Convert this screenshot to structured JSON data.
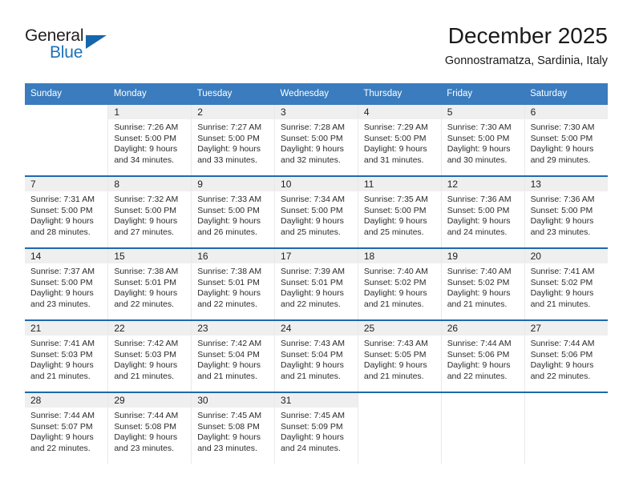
{
  "brand": {
    "name_top": "General",
    "name_bottom": "Blue",
    "triangle_color": "#1566ab",
    "blue_text_color": "#1d72b8"
  },
  "header": {
    "title": "December 2025",
    "subtitle": "Gonnostramatza, Sardinia, Italy"
  },
  "theme": {
    "header_row_bg": "#3a7cbe",
    "week_separator": "#1f69ad",
    "daynum_band_bg": "#efefef"
  },
  "weekdays": [
    "Sunday",
    "Monday",
    "Tuesday",
    "Wednesday",
    "Thursday",
    "Friday",
    "Saturday"
  ],
  "weeks": [
    [
      {
        "day": "",
        "blank": true,
        "sunrise": "",
        "sunset": "",
        "daylight1": "",
        "daylight2": ""
      },
      {
        "day": "1",
        "sunrise": "Sunrise: 7:26 AM",
        "sunset": "Sunset: 5:00 PM",
        "daylight1": "Daylight: 9 hours",
        "daylight2": "and 34 minutes."
      },
      {
        "day": "2",
        "sunrise": "Sunrise: 7:27 AM",
        "sunset": "Sunset: 5:00 PM",
        "daylight1": "Daylight: 9 hours",
        "daylight2": "and 33 minutes."
      },
      {
        "day": "3",
        "sunrise": "Sunrise: 7:28 AM",
        "sunset": "Sunset: 5:00 PM",
        "daylight1": "Daylight: 9 hours",
        "daylight2": "and 32 minutes."
      },
      {
        "day": "4",
        "sunrise": "Sunrise: 7:29 AM",
        "sunset": "Sunset: 5:00 PM",
        "daylight1": "Daylight: 9 hours",
        "daylight2": "and 31 minutes."
      },
      {
        "day": "5",
        "sunrise": "Sunrise: 7:30 AM",
        "sunset": "Sunset: 5:00 PM",
        "daylight1": "Daylight: 9 hours",
        "daylight2": "and 30 minutes."
      },
      {
        "day": "6",
        "sunrise": "Sunrise: 7:30 AM",
        "sunset": "Sunset: 5:00 PM",
        "daylight1": "Daylight: 9 hours",
        "daylight2": "and 29 minutes."
      }
    ],
    [
      {
        "day": "7",
        "sunrise": "Sunrise: 7:31 AM",
        "sunset": "Sunset: 5:00 PM",
        "daylight1": "Daylight: 9 hours",
        "daylight2": "and 28 minutes."
      },
      {
        "day": "8",
        "sunrise": "Sunrise: 7:32 AM",
        "sunset": "Sunset: 5:00 PM",
        "daylight1": "Daylight: 9 hours",
        "daylight2": "and 27 minutes."
      },
      {
        "day": "9",
        "sunrise": "Sunrise: 7:33 AM",
        "sunset": "Sunset: 5:00 PM",
        "daylight1": "Daylight: 9 hours",
        "daylight2": "and 26 minutes."
      },
      {
        "day": "10",
        "sunrise": "Sunrise: 7:34 AM",
        "sunset": "Sunset: 5:00 PM",
        "daylight1": "Daylight: 9 hours",
        "daylight2": "and 25 minutes."
      },
      {
        "day": "11",
        "sunrise": "Sunrise: 7:35 AM",
        "sunset": "Sunset: 5:00 PM",
        "daylight1": "Daylight: 9 hours",
        "daylight2": "and 25 minutes."
      },
      {
        "day": "12",
        "sunrise": "Sunrise: 7:36 AM",
        "sunset": "Sunset: 5:00 PM",
        "daylight1": "Daylight: 9 hours",
        "daylight2": "and 24 minutes."
      },
      {
        "day": "13",
        "sunrise": "Sunrise: 7:36 AM",
        "sunset": "Sunset: 5:00 PM",
        "daylight1": "Daylight: 9 hours",
        "daylight2": "and 23 minutes."
      }
    ],
    [
      {
        "day": "14",
        "sunrise": "Sunrise: 7:37 AM",
        "sunset": "Sunset: 5:00 PM",
        "daylight1": "Daylight: 9 hours",
        "daylight2": "and 23 minutes."
      },
      {
        "day": "15",
        "sunrise": "Sunrise: 7:38 AM",
        "sunset": "Sunset: 5:01 PM",
        "daylight1": "Daylight: 9 hours",
        "daylight2": "and 22 minutes."
      },
      {
        "day": "16",
        "sunrise": "Sunrise: 7:38 AM",
        "sunset": "Sunset: 5:01 PM",
        "daylight1": "Daylight: 9 hours",
        "daylight2": "and 22 minutes."
      },
      {
        "day": "17",
        "sunrise": "Sunrise: 7:39 AM",
        "sunset": "Sunset: 5:01 PM",
        "daylight1": "Daylight: 9 hours",
        "daylight2": "and 22 minutes."
      },
      {
        "day": "18",
        "sunrise": "Sunrise: 7:40 AM",
        "sunset": "Sunset: 5:02 PM",
        "daylight1": "Daylight: 9 hours",
        "daylight2": "and 21 minutes."
      },
      {
        "day": "19",
        "sunrise": "Sunrise: 7:40 AM",
        "sunset": "Sunset: 5:02 PM",
        "daylight1": "Daylight: 9 hours",
        "daylight2": "and 21 minutes."
      },
      {
        "day": "20",
        "sunrise": "Sunrise: 7:41 AM",
        "sunset": "Sunset: 5:02 PM",
        "daylight1": "Daylight: 9 hours",
        "daylight2": "and 21 minutes."
      }
    ],
    [
      {
        "day": "21",
        "sunrise": "Sunrise: 7:41 AM",
        "sunset": "Sunset: 5:03 PM",
        "daylight1": "Daylight: 9 hours",
        "daylight2": "and 21 minutes."
      },
      {
        "day": "22",
        "sunrise": "Sunrise: 7:42 AM",
        "sunset": "Sunset: 5:03 PM",
        "daylight1": "Daylight: 9 hours",
        "daylight2": "and 21 minutes."
      },
      {
        "day": "23",
        "sunrise": "Sunrise: 7:42 AM",
        "sunset": "Sunset: 5:04 PM",
        "daylight1": "Daylight: 9 hours",
        "daylight2": "and 21 minutes."
      },
      {
        "day": "24",
        "sunrise": "Sunrise: 7:43 AM",
        "sunset": "Sunset: 5:04 PM",
        "daylight1": "Daylight: 9 hours",
        "daylight2": "and 21 minutes."
      },
      {
        "day": "25",
        "sunrise": "Sunrise: 7:43 AM",
        "sunset": "Sunset: 5:05 PM",
        "daylight1": "Daylight: 9 hours",
        "daylight2": "and 21 minutes."
      },
      {
        "day": "26",
        "sunrise": "Sunrise: 7:44 AM",
        "sunset": "Sunset: 5:06 PM",
        "daylight1": "Daylight: 9 hours",
        "daylight2": "and 22 minutes."
      },
      {
        "day": "27",
        "sunrise": "Sunrise: 7:44 AM",
        "sunset": "Sunset: 5:06 PM",
        "daylight1": "Daylight: 9 hours",
        "daylight2": "and 22 minutes."
      }
    ],
    [
      {
        "day": "28",
        "sunrise": "Sunrise: 7:44 AM",
        "sunset": "Sunset: 5:07 PM",
        "daylight1": "Daylight: 9 hours",
        "daylight2": "and 22 minutes."
      },
      {
        "day": "29",
        "sunrise": "Sunrise: 7:44 AM",
        "sunset": "Sunset: 5:08 PM",
        "daylight1": "Daylight: 9 hours",
        "daylight2": "and 23 minutes."
      },
      {
        "day": "30",
        "sunrise": "Sunrise: 7:45 AM",
        "sunset": "Sunset: 5:08 PM",
        "daylight1": "Daylight: 9 hours",
        "daylight2": "and 23 minutes."
      },
      {
        "day": "31",
        "sunrise": "Sunrise: 7:45 AM",
        "sunset": "Sunset: 5:09 PM",
        "daylight1": "Daylight: 9 hours",
        "daylight2": "and 24 minutes."
      },
      {
        "day": "",
        "blank": true,
        "sunrise": "",
        "sunset": "",
        "daylight1": "",
        "daylight2": ""
      },
      {
        "day": "",
        "blank": true,
        "sunrise": "",
        "sunset": "",
        "daylight1": "",
        "daylight2": ""
      },
      {
        "day": "",
        "blank": true,
        "sunrise": "",
        "sunset": "",
        "daylight1": "",
        "daylight2": ""
      }
    ]
  ]
}
